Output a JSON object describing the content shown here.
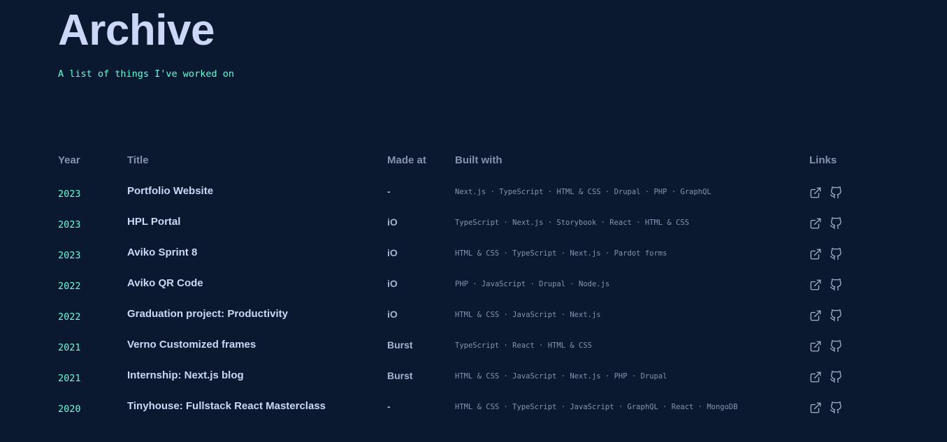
{
  "page": {
    "title": "Archive",
    "subtitle": "A list of things I've worked on"
  },
  "table": {
    "headers": {
      "year": "Year",
      "title": "Title",
      "made_at": "Made at",
      "built_with": "Built with",
      "links": "Links"
    },
    "rows": [
      {
        "year": "2023",
        "title": "Portfolio Website",
        "made_at": "-",
        "built_with": "Next.js · TypeScript · HTML & CSS · Drupal · PHP · GraphQL"
      },
      {
        "year": "2023",
        "title": "HPL Portal",
        "made_at": "iO",
        "built_with": "TypeScript · Next.js · Storybook · React · HTML & CSS"
      },
      {
        "year": "2023",
        "title": "Aviko Sprint 8",
        "made_at": "iO",
        "built_with": "HTML & CSS · TypeScript · Next.js · Pardot forms"
      },
      {
        "year": "2022",
        "title": "Aviko QR Code",
        "made_at": "iO",
        "built_with": "PHP · JavaScript · Drupal · Node.js"
      },
      {
        "year": "2022",
        "title": "Graduation project: Productivity",
        "made_at": "iO",
        "built_with": "HTML & CSS · JavaScript · Next.js"
      },
      {
        "year": "2021",
        "title": "Verno Customized frames",
        "made_at": "Burst",
        "built_with": "TypeScript · React · HTML & CSS"
      },
      {
        "year": "2021",
        "title": "Internship: Next.js blog",
        "made_at": "Burst",
        "built_with": "HTML & CSS · JavaScript · Next.js · PHP · Drupal"
      },
      {
        "year": "2020",
        "title": "Tinyhouse: Fullstack React Masterclass",
        "made_at": "-",
        "built_with": "HTML & CSS · TypeScript · JavaScript · GraphQL · React · MongoDB"
      }
    ]
  },
  "icons": {
    "external": "external-link-icon",
    "github": "github-icon"
  },
  "colors": {
    "background": "#0a192f",
    "accent": "#64ffda",
    "heading": "#ccd6f6",
    "muted": "#8892b0"
  }
}
